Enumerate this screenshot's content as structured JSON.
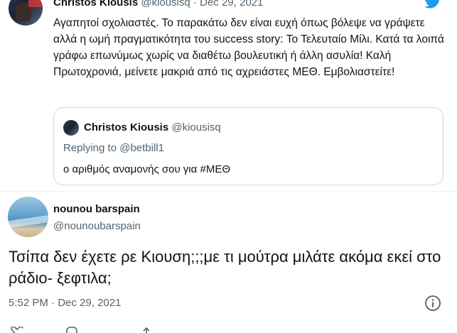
{
  "parent_tweet": {
    "name": "Christos Kiousis",
    "handle": "@kiousisq",
    "separator": "·",
    "date": "Dec 29, 2021",
    "text": "Αγαπητοί σχολιαστές. Το παρακάτω δεν είναι ευχή όπως βόλεψε να γράψετε αλλά η ωμή πραγματικότητα του success story: Το Τελευταίο Μίλι. Κατά τα λοιπά γράφω επωνύμως χωρίς να διαθέτω βουλευτική ή άλλη ασυλία! Καλή Πρωτοχρονιά, μείνετε μακριά από τις αχρειάστες ΜΕΘ. Εμβολιαστείτε!",
    "quote": {
      "name": "Christos Kiousis",
      "handle": "@kiousisq",
      "replying_prefix": "Replying to",
      "replying_to": "@betbill1",
      "text": "ο αριθμός αναμονής σου για #ΜΕΘ"
    }
  },
  "main_tweet": {
    "name": "nounou barspain",
    "handle": "@nounoubarspain",
    "text": "Τσίπα δεν έχετε ρε Κιουση;;;με τι μούτρα μιλάτε ακόμα εκεί στο ράδιο- ξεφτιλα;",
    "timestamp": "5:52 PM · Dec 29, 2021"
  },
  "icons": {
    "brand": "twitter-bird-icon",
    "info": "info-icon",
    "actions": [
      "like-icon",
      "reply-icon",
      "share-icon"
    ]
  },
  "colors": {
    "brand_blue": "#1d9bf0",
    "text_primary": "#0f1419",
    "text_secondary": "#536471",
    "border": "#cfd9de"
  }
}
